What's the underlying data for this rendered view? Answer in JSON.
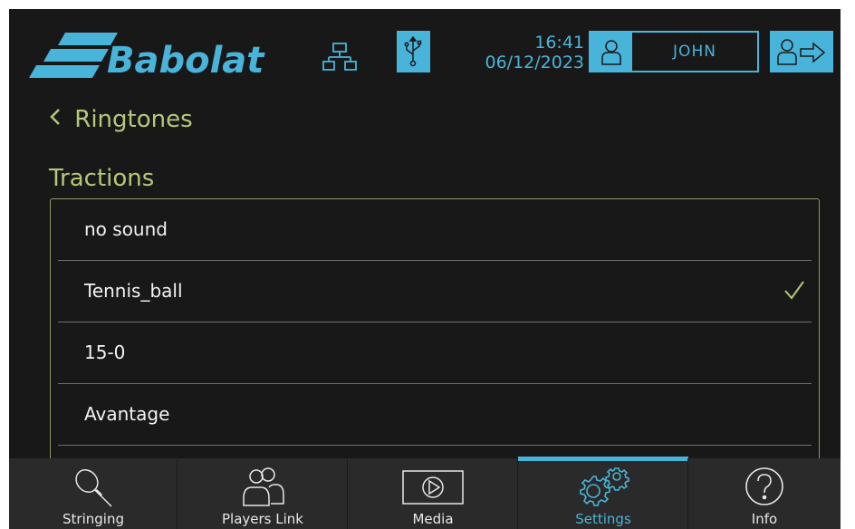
{
  "header": {
    "brand": "Babolat",
    "time": "16:41",
    "date": "06/12/2023",
    "user_name": "JOHN",
    "accent_color": "#49b4d9",
    "icons": [
      "network-icon",
      "usb-icon",
      "user-icon",
      "logout-icon"
    ]
  },
  "page": {
    "back_label": "Ringtones",
    "section_title": "Tractions",
    "accent_text_color": "#b3c87a",
    "items": [
      {
        "label": "no sound",
        "selected": false
      },
      {
        "label": "Tennis_ball",
        "selected": true
      },
      {
        "label": "15-0",
        "selected": false
      },
      {
        "label": "Avantage",
        "selected": false
      }
    ]
  },
  "nav": {
    "items": [
      {
        "label": "Stringing",
        "icon": "racket-icon",
        "active": false
      },
      {
        "label": "Players Link",
        "icon": "players-icon",
        "active": false
      },
      {
        "label": "Media",
        "icon": "play-icon",
        "active": false
      },
      {
        "label": "Settings",
        "icon": "gears-icon",
        "active": true
      },
      {
        "label": "Info",
        "icon": "question-icon",
        "active": false
      }
    ]
  }
}
